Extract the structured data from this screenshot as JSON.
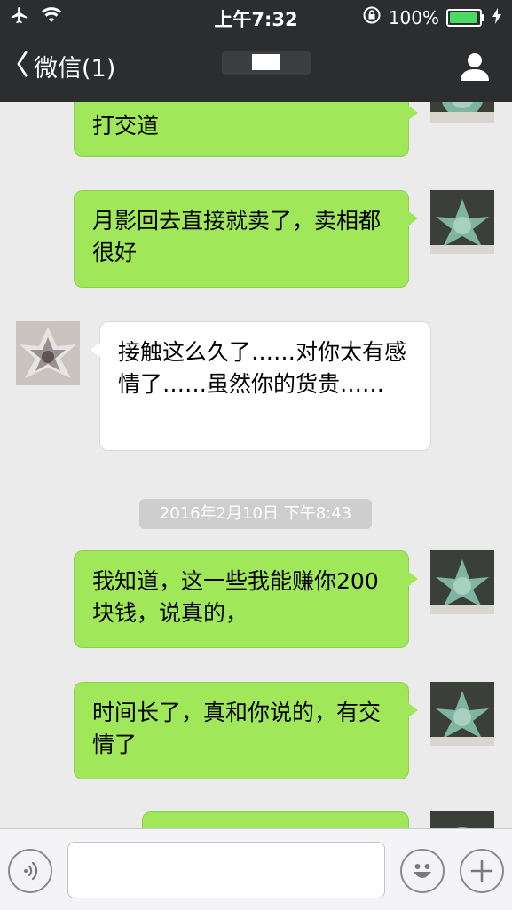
{
  "status_bar": {
    "time": "上午7:32",
    "battery": "100%",
    "icons": [
      "airplane-icon",
      "wifi-icon",
      "rotation-lock-icon",
      "battery-icon",
      "charging-icon"
    ]
  },
  "nav": {
    "back_label": "微信(1)",
    "icons": [
      "chevron-left-icon",
      "profile-icon"
    ]
  },
  "messages": [
    {
      "side": "out",
      "text": "打交道"
    },
    {
      "side": "out",
      "text": "月影回去直接就卖了，卖相都很好"
    },
    {
      "side": "in",
      "text": "接触这么久了……对你太有感情了……虽然你的货贵……"
    },
    {
      "side": "out",
      "text": "我知道，这一些我能赚你200块钱，说真的，"
    },
    {
      "side": "out",
      "text": "时间长了，真和你说的，有交情了"
    }
  ],
  "timestamp": "2016年2月10日 下午8:43",
  "input_bar": {
    "icons": [
      "voice-icon",
      "emoji-icon",
      "plus-icon"
    ],
    "text_value": ""
  },
  "colors": {
    "header_bg": "#2b2d2e",
    "chat_bg": "#ebebeb",
    "outgoing_bubble": "#a0e75a",
    "incoming_bubble": "#ffffff",
    "battery_fill": "#4cd964"
  }
}
